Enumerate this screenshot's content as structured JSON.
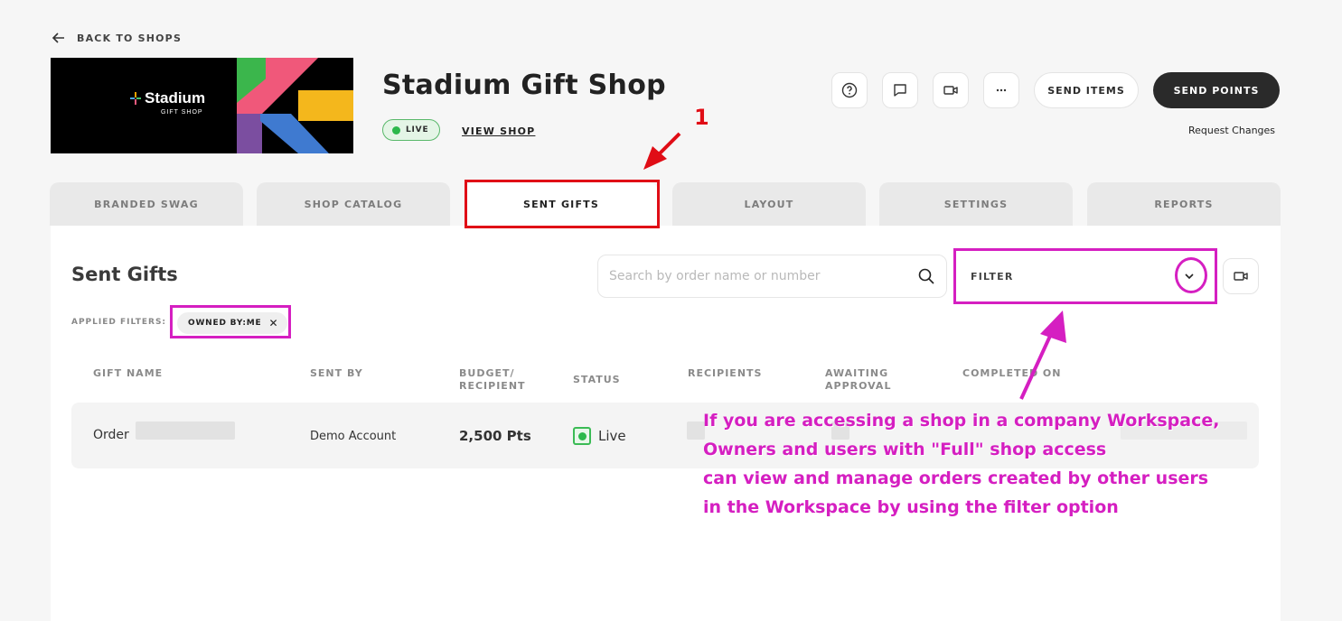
{
  "header": {
    "back_label": "BACK TO SHOPS",
    "banner": {
      "brand": "Stadium",
      "sub": "GIFT SHOP"
    },
    "shop_title": "Stadium Gift Shop",
    "status_badge": "LIVE",
    "view_shop": "VIEW SHOP",
    "icons": [
      "help-icon",
      "chat-icon",
      "video-icon",
      "more-icon"
    ],
    "send_items": "SEND ITEMS",
    "send_points": "SEND POINTS",
    "request_changes": "Request Changes"
  },
  "tabs": [
    {
      "label": "BRANDED SWAG",
      "active": false
    },
    {
      "label": "SHOP CATALOG",
      "active": false
    },
    {
      "label": "SENT GIFTS",
      "active": true
    },
    {
      "label": "LAYOUT",
      "active": false
    },
    {
      "label": "SETTINGS",
      "active": false
    },
    {
      "label": "REPORTS",
      "active": false
    }
  ],
  "main": {
    "title": "Sent Gifts",
    "search_placeholder": "Search by order name or number",
    "filter_label": "FILTER",
    "applied_filters_label": "APPLIED FILTERS:",
    "applied_filter_chip": "OWNED BY:ME",
    "columns": {
      "gift_name": "GIFT NAME",
      "sent_by": "SENT BY",
      "budget_1": "BUDGET/",
      "budget_2": "RECIPIENT",
      "status": "STATUS",
      "recipients": "RECIPIENTS",
      "awaiting_1": "AWAITING",
      "awaiting_2": "APPROVAL",
      "completed": "COMPLETED ON"
    },
    "rows": [
      {
        "gift_name": "Order",
        "sent_by": "Demo Account",
        "budget": "2,500 Pts",
        "status": "Live"
      }
    ]
  },
  "annotation": {
    "step_number": "1",
    "lines": [
      "If you are accessing a shop in a company Workspace,",
      "Owners and users with \"Full\" shop access",
      "can view and manage orders created by other users",
      "in the Workspace by using the filter option"
    ],
    "colors": {
      "red": "#e00d16",
      "magenta": "#d51fc1"
    }
  }
}
